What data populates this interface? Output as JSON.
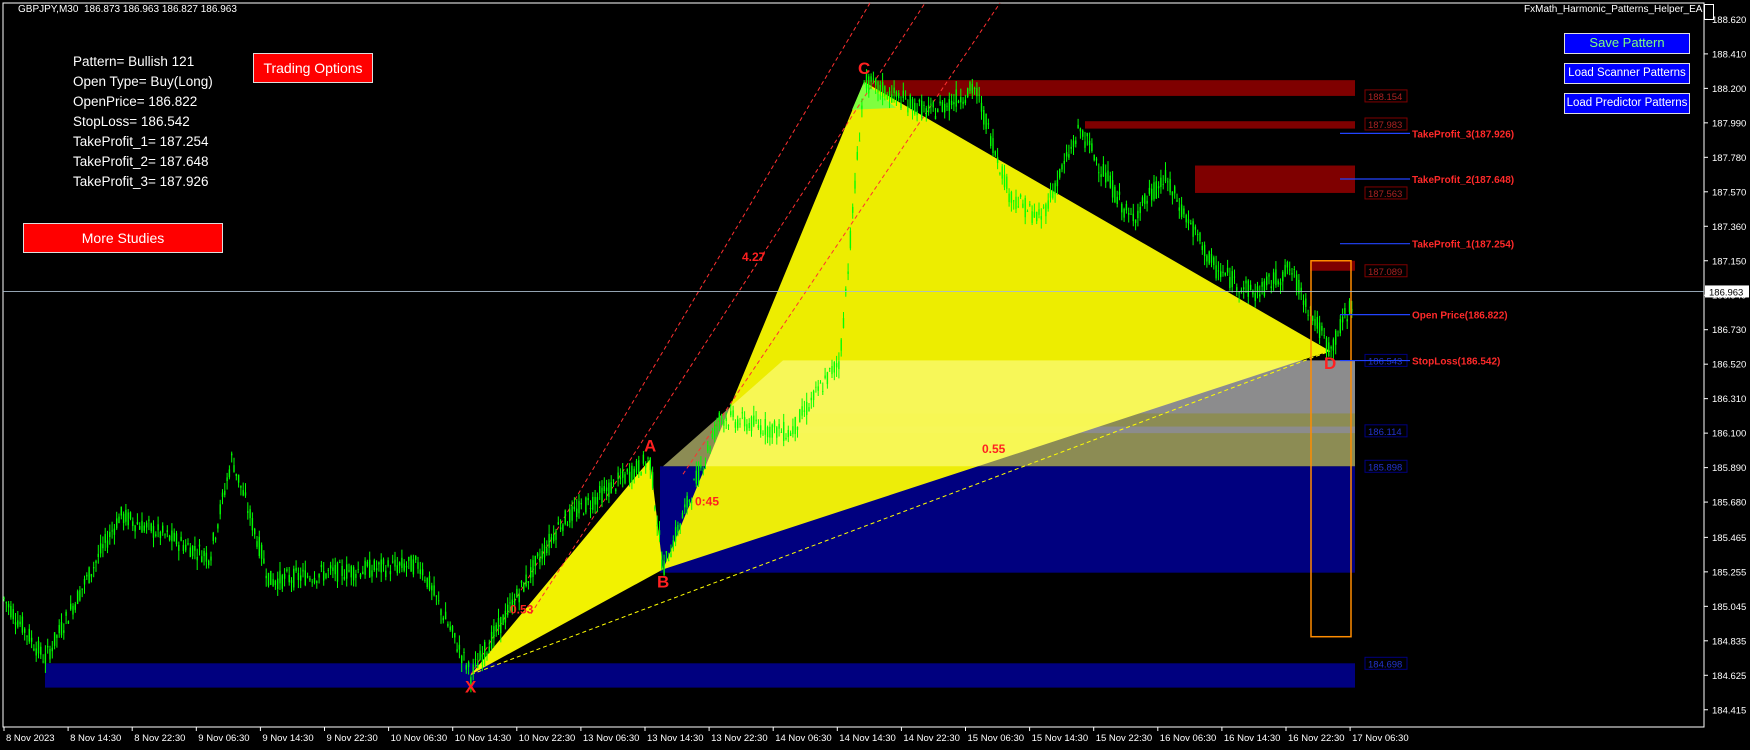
{
  "header": {
    "symbol": "GBPJPY,M30",
    "quote": "186.873 186.963 186.827 186.963",
    "ea_name": "FxMath_Harmonic_Patterns_Helper_EA"
  },
  "info": {
    "pattern": "Pattern= Bullish 121",
    "open_type": "Open Type= Buy(Long)",
    "open_price": "OpenPrice= 186.822",
    "stop_loss": "StopLoss= 186.542",
    "tp1": "TakeProfit_1= 187.254",
    "tp2": "TakeProfit_2= 187.648",
    "tp3": "TakeProfit_3= 187.926"
  },
  "buttons": {
    "trading_options": "Trading Options",
    "more_studies": "More Studies",
    "save_pattern": "Save Pattern",
    "load_scanner": "Load Scanner Patterns",
    "load_predictor": "Load Predictor Patterns"
  },
  "chart_data": {
    "type": "candlestick",
    "symbol": "GBPJPY",
    "timeframe": "M30",
    "ylim": [
      184.31,
      188.72
    ],
    "y_ticks": [
      "188.620",
      "188.410",
      "188.200",
      "187.990",
      "187.780",
      "187.570",
      "187.360",
      "187.150",
      "186.940",
      "186.730",
      "186.520",
      "186.310",
      "186.100",
      "185.890",
      "185.680",
      "185.465",
      "185.255",
      "185.045",
      "184.835",
      "184.625",
      "184.415"
    ],
    "x_ticks": [
      "8 Nov 2023",
      "8 Nov 14:30",
      "8 Nov 22:30",
      "9 Nov 06:30",
      "9 Nov 14:30",
      "9 Nov 22:30",
      "10 Nov 06:30",
      "10 Nov 14:30",
      "10 Nov 22:30",
      "13 Nov 06:30",
      "13 Nov 14:30",
      "13 Nov 22:30",
      "14 Nov 06:30",
      "14 Nov 14:30",
      "14 Nov 22:30",
      "15 Nov 06:30",
      "15 Nov 14:30",
      "15 Nov 22:30",
      "16 Nov 06:30",
      "16 Nov 14:30",
      "16 Nov 22:30",
      "17 Nov 06:30"
    ],
    "current_price": "186.963",
    "current_price_value": 186.963,
    "pattern_points": [
      {
        "label": "X",
        "price": 184.63
      },
      {
        "label": "A",
        "price": 185.94
      },
      {
        "label": "B",
        "price": 185.27
      },
      {
        "label": "C",
        "price": 188.24
      },
      {
        "label": "D",
        "price": 186.6
      }
    ],
    "ratios": [
      {
        "text": "0.53"
      },
      {
        "text": "4.27"
      },
      {
        "text": "0:45"
      },
      {
        "text": "0.55"
      }
    ],
    "zone_labels": [
      "188.154",
      "187.983",
      "187.563",
      "187.089",
      "186.543",
      "186.114",
      "185.898",
      "184.698"
    ],
    "levels": [
      {
        "name": "TakeProfit_3(187.926)",
        "price": 187.926,
        "color": "#ff2a2a",
        "line": "#2244ff"
      },
      {
        "name": "TakeProfit_2(187.648)",
        "price": 187.648,
        "color": "#ff2a2a",
        "line": "#2244ff"
      },
      {
        "name": "TakeProfit_1(187.254)",
        "price": 187.254,
        "color": "#ff2a2a",
        "line": "#2244ff"
      },
      {
        "name": "Open Price(186.822)",
        "price": 186.822,
        "color": "#ff2a2a",
        "line": "#2244ff"
      },
      {
        "name": "StopLoss(186.542)",
        "price": 186.542,
        "color": "#ff2a2a",
        "line": "#2244ff"
      }
    ]
  },
  "colors": {
    "background": "#000000",
    "candle": "#00ff00",
    "pattern_fill": "#ffff00",
    "pattern_light": "#ffff99",
    "zone_blue": "#00007f",
    "zone_red": "#7f0000",
    "label_red": "#ff2020",
    "button_red": "#ff0000",
    "button_blue": "#0000ff"
  }
}
